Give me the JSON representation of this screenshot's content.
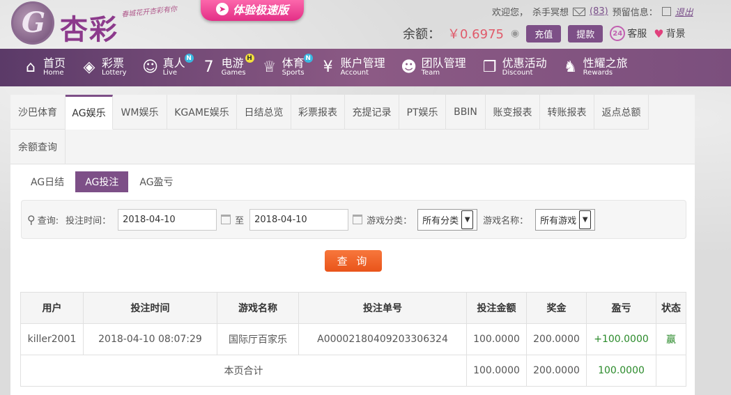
{
  "header": {
    "brand": "杏彩",
    "slogan": "春城花开杏彩有你",
    "promo": "体验极速版",
    "welcome": "欢迎您，",
    "username": "杀手冥想",
    "message_count": "(83)",
    "warning_label": "预留信息：",
    "logout": "退出",
    "balance_label": "余额：",
    "balance_value": "￥0.6975",
    "deposit": "充值",
    "withdraw": "提款",
    "service": "客服",
    "background": "背景"
  },
  "nav": [
    {
      "zh": "首页",
      "en": "Home",
      "icon": "home-icon",
      "glyph": "⌂"
    },
    {
      "zh": "彩票",
      "en": "Lottery",
      "icon": "lottery-icon",
      "glyph": "◈"
    },
    {
      "zh": "真人",
      "en": "Live",
      "icon": "live-icon",
      "glyph": "☺",
      "badge": "N"
    },
    {
      "zh": "电游",
      "en": "Games",
      "icon": "games-icon",
      "glyph": "7",
      "badge": "H"
    },
    {
      "zh": "体育",
      "en": "Sports",
      "icon": "sports-icon",
      "glyph": "♕",
      "badge": "N"
    },
    {
      "zh": "账户管理",
      "en": "Account",
      "icon": "account-icon",
      "glyph": "¥"
    },
    {
      "zh": "团队管理",
      "en": "Team",
      "icon": "team-icon",
      "glyph": "☻"
    },
    {
      "zh": "优惠活动",
      "en": "Discount",
      "icon": "gift-icon",
      "glyph": "❒"
    },
    {
      "zh": "性耀之旅",
      "en": "Rewards",
      "icon": "rewards-icon",
      "glyph": "♞"
    }
  ],
  "tabs": [
    "沙巴体育",
    "AG娱乐",
    "WM娱乐",
    "KGAME娱乐",
    "日结总览",
    "彩票报表",
    "充提记录",
    "PT娱乐",
    "BBIN",
    "账变报表",
    "转账报表",
    "返点总额",
    "余额查询"
  ],
  "subtabs": [
    "AG日结",
    "AG投注",
    "AG盈亏"
  ],
  "filter": {
    "query_label": "查询:",
    "time_label": "投注时间：",
    "start_date": "2018-04-10",
    "to": "至",
    "end_date": "2018-04-10",
    "category_label": "游戏分类：",
    "category_value": "所有分类",
    "game_label": "游戏名称：",
    "game_value": "所有游戏",
    "query_button": "查 询"
  },
  "table": {
    "headers": [
      "用户",
      "投注时间",
      "游戏名称",
      "投注单号",
      "投注金额",
      "奖金",
      "盈亏",
      "状态"
    ],
    "rows": [
      [
        "killer2001",
        "2018-04-10 08:07:29",
        "国际厅百家乐",
        "A00002180409203306324",
        "100.0000",
        "200.0000",
        "+100.0000",
        "赢"
      ]
    ],
    "total": {
      "label": "本页合计",
      "bet": "100.0000",
      "prize": "200.0000",
      "profit": "100.0000"
    }
  }
}
